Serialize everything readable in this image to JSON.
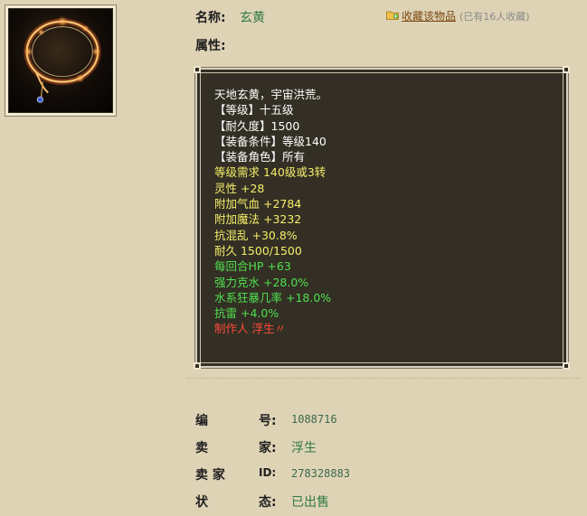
{
  "item": {
    "name_label": "名称:",
    "name": "玄黄",
    "attr_label": "属性:",
    "favorite_link": "收藏该物品",
    "favorite_count": "(已有16人收藏)"
  },
  "attributes": [
    {
      "text": "天地玄黄，宇宙洪荒。",
      "color": "#ffffff"
    },
    {
      "text": "【等级】十五级",
      "color": "#ffffff"
    },
    {
      "text": "【耐久度】1500",
      "color": "#ffffff"
    },
    {
      "text": "【装备条件】等级140",
      "color": "#ffffff"
    },
    {
      "text": "【装备角色】所有",
      "color": "#ffffff"
    },
    {
      "text": "等级需求 140级或3转",
      "color": "#f5ee6b"
    },
    {
      "text": "灵性 +28",
      "color": "#f5ee6b"
    },
    {
      "text": "附加气血 +2784",
      "color": "#f5ee6b"
    },
    {
      "text": "附加魔法 +3232",
      "color": "#f5ee6b"
    },
    {
      "text": "抗混乱 +30.8%",
      "color": "#f5ee6b"
    },
    {
      "text": "耐久 1500/1500",
      "color": "#f5ee6b"
    },
    {
      "text": "每回合HP +63",
      "color": "#4fe04f"
    },
    {
      "text": "强力克水 +28.0%",
      "color": "#4fe04f"
    },
    {
      "text": "水系狂暴几率 +18.0%",
      "color": "#4fe04f"
    },
    {
      "text": "抗雷 +4.0%",
      "color": "#4fe04f"
    },
    {
      "text": "制作人 浮生〃",
      "color": "#ff4a3a"
    }
  ],
  "details": {
    "id_label_a": "编",
    "id_label_b": "号:",
    "id_value": "1088716",
    "seller_label_a": "卖",
    "seller_label_b": "家:",
    "seller_value": "浮生",
    "seller_id_label_a": "卖 家",
    "seller_id_label_b": "ID:",
    "seller_id_value": "278328883",
    "status_label_a": "状",
    "status_label_b": "态:",
    "status_value": "已出售"
  }
}
